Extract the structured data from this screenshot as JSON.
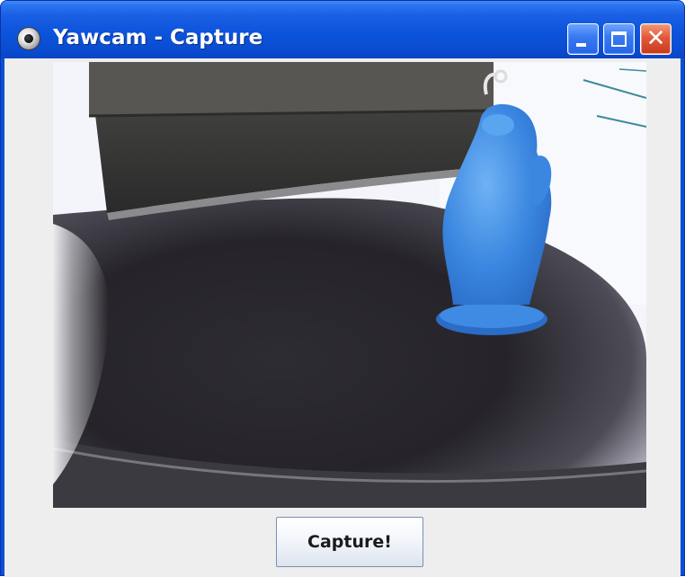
{
  "window": {
    "title": "Yawcam - Capture",
    "icon": "webcam-lens-icon",
    "controls": {
      "minimize_icon": "minimize-icon",
      "maximize_icon": "maximize-icon",
      "close_icon": "close-icon",
      "close_glyph": "✕"
    }
  },
  "preview": {
    "description_icon": "webcam-preview-image"
  },
  "actions": {
    "capture_label": "Capture!"
  },
  "colors": {
    "titlebar_blue": "#0a4fd8",
    "client_background": "#eeeeee",
    "close_red": "#e1593a"
  }
}
